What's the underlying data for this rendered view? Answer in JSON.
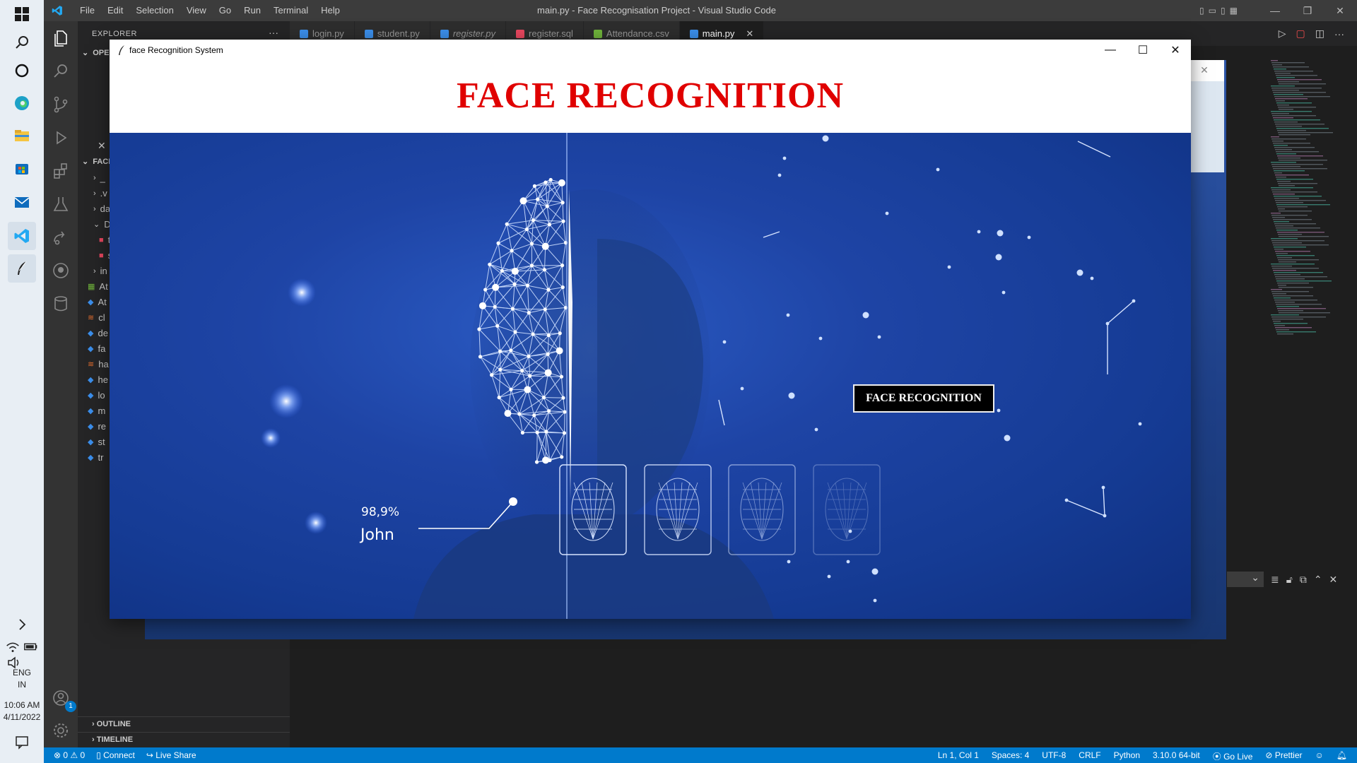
{
  "taskbar": {
    "keyboard": "ENG",
    "region": "IN",
    "time": "10:06 AM",
    "date": "4/11/2022"
  },
  "vscode": {
    "menu": [
      "File",
      "Edit",
      "Selection",
      "View",
      "Go",
      "Run",
      "Terminal",
      "Help"
    ],
    "title": "main.py - Face Recognisation Project - Visual Studio Code",
    "explorer_label": "EXPLORER",
    "open_editors_label": "OPEI",
    "folder_label": "FACE",
    "outline_label": "OUTLINE",
    "timeline_label": "TIMELINE",
    "tree_items": [
      "_",
      ".v",
      "da",
      "Di",
      "ti",
      "s",
      "in",
      "At",
      "At",
      "cl",
      "de",
      "fa",
      "ha",
      "he",
      "lo",
      "m",
      "re",
      "st",
      "tr"
    ],
    "tabs": [
      {
        "label": "login.py",
        "color": "#3b8eea",
        "active": false
      },
      {
        "label": "student.py",
        "color": "#3b8eea",
        "active": false
      },
      {
        "label": "register.py",
        "color": "#3b8eea",
        "active": false
      },
      {
        "label": "register.sql",
        "color": "#e8475f",
        "active": false
      },
      {
        "label": "Attendance.csv",
        "color": "#6fb33b",
        "active": false
      },
      {
        "label": "main.py",
        "color": "#3b8eea",
        "active": true
      }
    ],
    "status_left": {
      "errors": "0",
      "warnings": "0",
      "connect": "Connect",
      "live_share": "Live Share"
    },
    "status_right": [
      "Ln 1, Col 1",
      "Spaces: 4",
      "UTF-8",
      "CRLF",
      "Python",
      "3.10.0 64-bit",
      "Go Live",
      "Prettier"
    ],
    "account_badge": "1"
  },
  "app": {
    "window_title": "face Recognition System",
    "heading": "FACE RECOGNITION",
    "button_label": "FACE RECOGNITION",
    "confidence": "98,9%",
    "name": "John"
  },
  "colors": {
    "heading": "#e00000",
    "accent": "#007acc",
    "hero": "#1e44a5"
  }
}
